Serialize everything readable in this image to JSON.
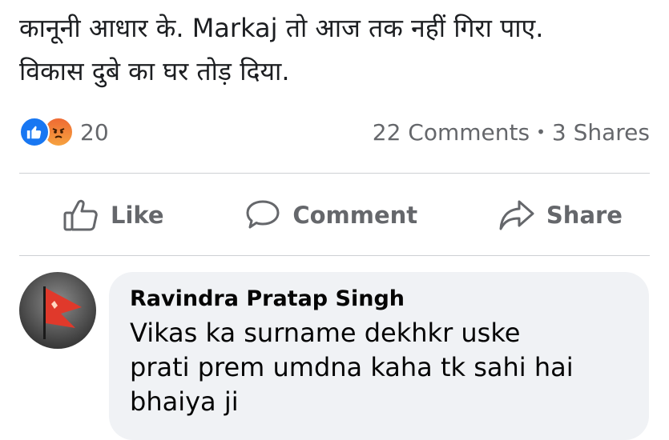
{
  "post": {
    "text_lines": [
      "कानूनी आधार के. Markaj तो आज तक नहीं गिरा पाए.",
      "विकास दुबे का घर तोड़ दिया."
    ]
  },
  "stats": {
    "reaction_count": "20",
    "comments": "22 Comments",
    "separator": "•",
    "shares": "3 Shares",
    "reactions": [
      "like-reaction-icon",
      "angry-reaction-icon"
    ]
  },
  "actions": {
    "like_label": "Like",
    "comment_label": "Comment",
    "share_label": "Share"
  },
  "comment": {
    "author": "Ravindra Pratap Singh",
    "text_lines": [
      "Vikas ka surname dekhkr  uske",
      "prati prem umdna kaha tk sahi  hai",
      "bhaiya ji"
    ]
  },
  "colors": {
    "like_blue": "#1877f2",
    "angry_orange": "#ef6a33",
    "muted_text": "#65676b",
    "bubble_bg": "#f0f2f5",
    "flag_red": "#e0392b"
  }
}
